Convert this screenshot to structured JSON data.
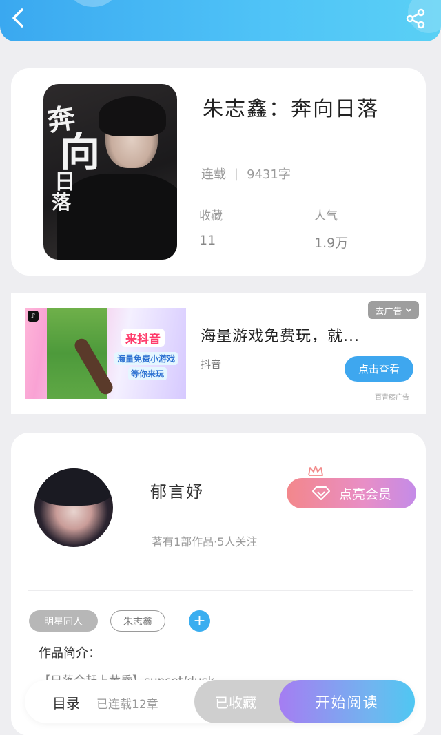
{
  "header": {
    "back_icon": "chevron-left-icon",
    "share_icon": "share-icon",
    "bg_color": "#4fc3f7"
  },
  "book": {
    "title": "朱志鑫：奔向日落",
    "status": "连载",
    "word_count": "9431字",
    "fav_label": "收藏",
    "fav_value": "11",
    "pop_label": "人气",
    "pop_value": "1.9万",
    "cover_text": [
      "奔",
      "向",
      "日",
      "落"
    ]
  },
  "ad": {
    "close_label": "去广告",
    "headline": "海量游戏免费玩，就...",
    "source": "抖音",
    "cta": "点击查看",
    "note": "百青藤广告",
    "promo_title": "来抖音",
    "promo_line1": "海量免费小游戏",
    "promo_line2": "等你来玩"
  },
  "author": {
    "name": "郁言妤",
    "meta": "著有1部作品·5人关注",
    "vip_label": "点亮会员",
    "tags": [
      "明星同人",
      "朱志鑫"
    ],
    "add_tag": "+",
    "intro_label": "作品简介：",
    "intro_text": "【日落会赶上黄昏】sunset/dusk"
  },
  "bottom": {
    "toc_label": "目录",
    "chapter_count": "已连载12章",
    "fav_button": "已收藏",
    "read_button": "开始阅读"
  },
  "colors": {
    "accent": "#3ea7ef",
    "vip_gradient_start": "#f3878b",
    "vip_gradient_end": "#c48be8"
  }
}
